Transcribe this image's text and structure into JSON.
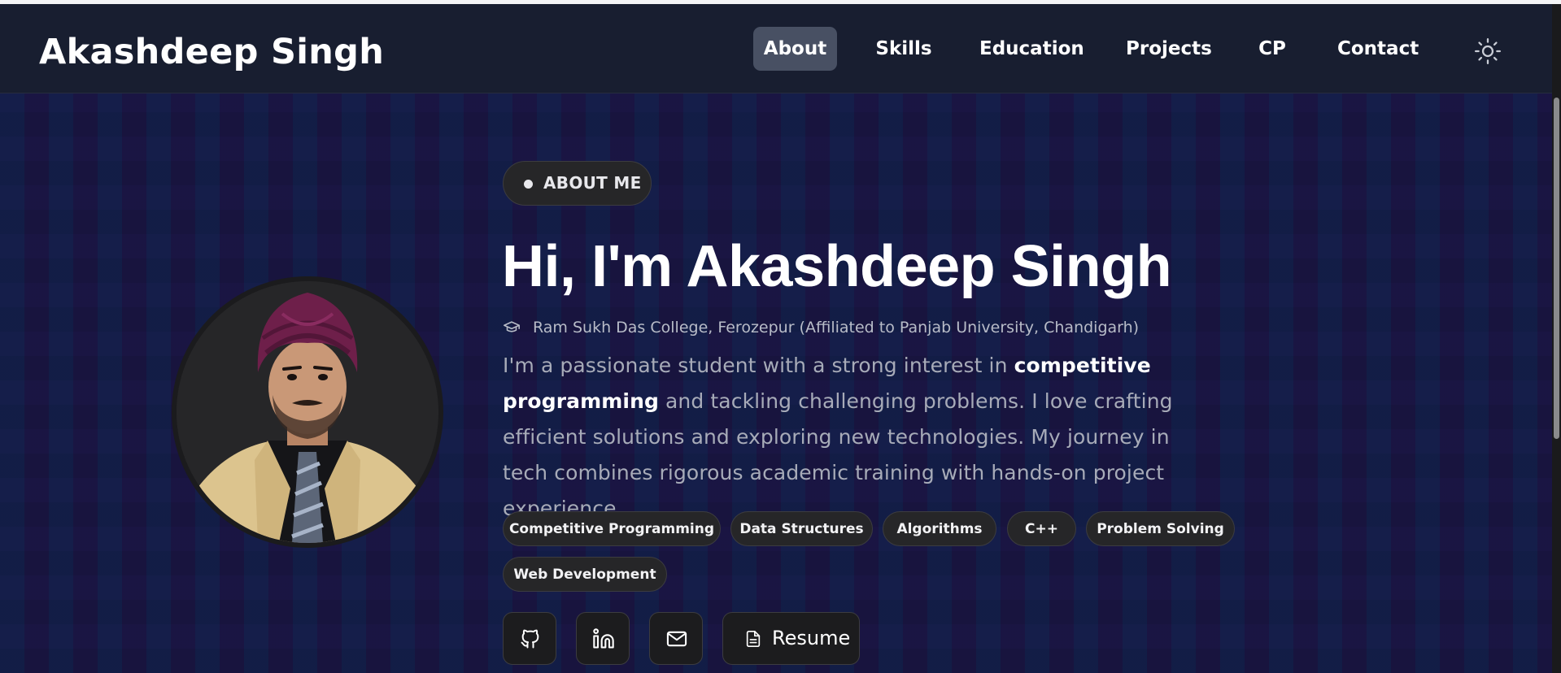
{
  "navbar": {
    "brand": "Akashdeep Singh",
    "links": [
      {
        "label": "About",
        "active": true
      },
      {
        "label": "Skills",
        "active": false
      },
      {
        "label": "Education",
        "active": false
      },
      {
        "label": "Projects",
        "active": false
      },
      {
        "label": "CP",
        "active": false
      },
      {
        "label": "Contact",
        "active": false
      }
    ],
    "theme_toggle_icon": "sun-icon"
  },
  "hero": {
    "badge": "ABOUT ME",
    "title": "Hi, I'm Akashdeep Singh",
    "college_icon": "graduation-cap-icon",
    "college": "Ram Sukh Das College, Ferozepur (Affiliated to Panjab University, Chandigarh)",
    "bio": {
      "intro": "I'm a passionate student with a strong interest in ",
      "highlight": "competitive programming",
      "rest": " and tackling challenging problems. I love crafting efficient solutions and exploring new technologies. My journey in tech combines rigorous academic training with hands-on project experience."
    },
    "tags": [
      "Competitive Programming",
      "Data Structures",
      "Algorithms",
      "C++",
      "Problem Solving",
      "Web Development"
    ],
    "social": [
      {
        "icon": "github-icon"
      },
      {
        "icon": "linkedin-icon"
      },
      {
        "icon": "mail-icon"
      }
    ],
    "resume_button": {
      "icon": "file-icon",
      "label": "Resume"
    }
  },
  "colors": {
    "background": "#0e1635",
    "navbar": "#181e30",
    "active_nav": "#485063",
    "chip": "#262628",
    "text_muted": "#a7abb8"
  }
}
